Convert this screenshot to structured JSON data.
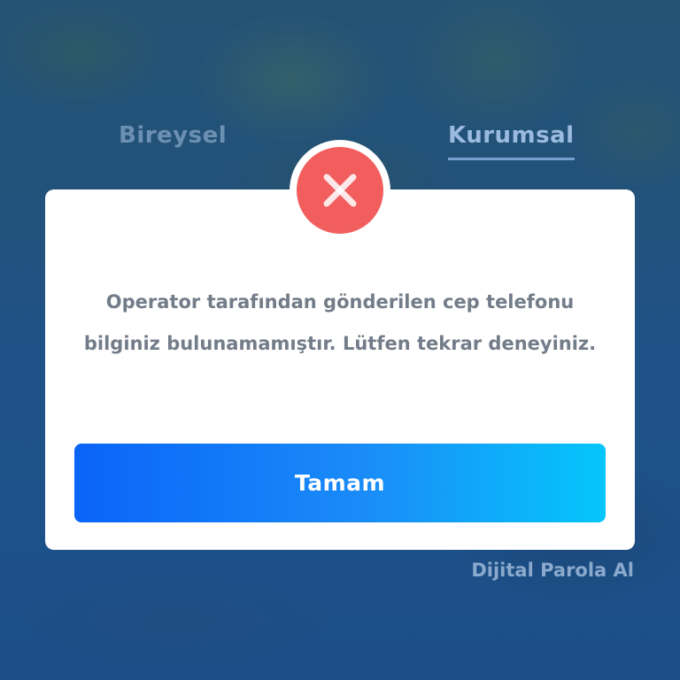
{
  "tabs": {
    "bireysel": "Bireysel",
    "kurumsal": "Kurumsal",
    "active": "kurumsal"
  },
  "links": {
    "dijital_parola": "Dijital Parola Al"
  },
  "dialog": {
    "type": "error",
    "icon": "close-x-icon",
    "message": "Operator tarafından gönderilen cep telefonu bilginiz bulunamamıştır. Lütfen tekrar deneyiniz.",
    "button_label": "Tamam"
  },
  "colors": {
    "error_red": "#f25e5e",
    "button_gradient_start": "#0a64f8",
    "button_gradient_end": "#05c6fb",
    "message_text": "#737c89"
  }
}
